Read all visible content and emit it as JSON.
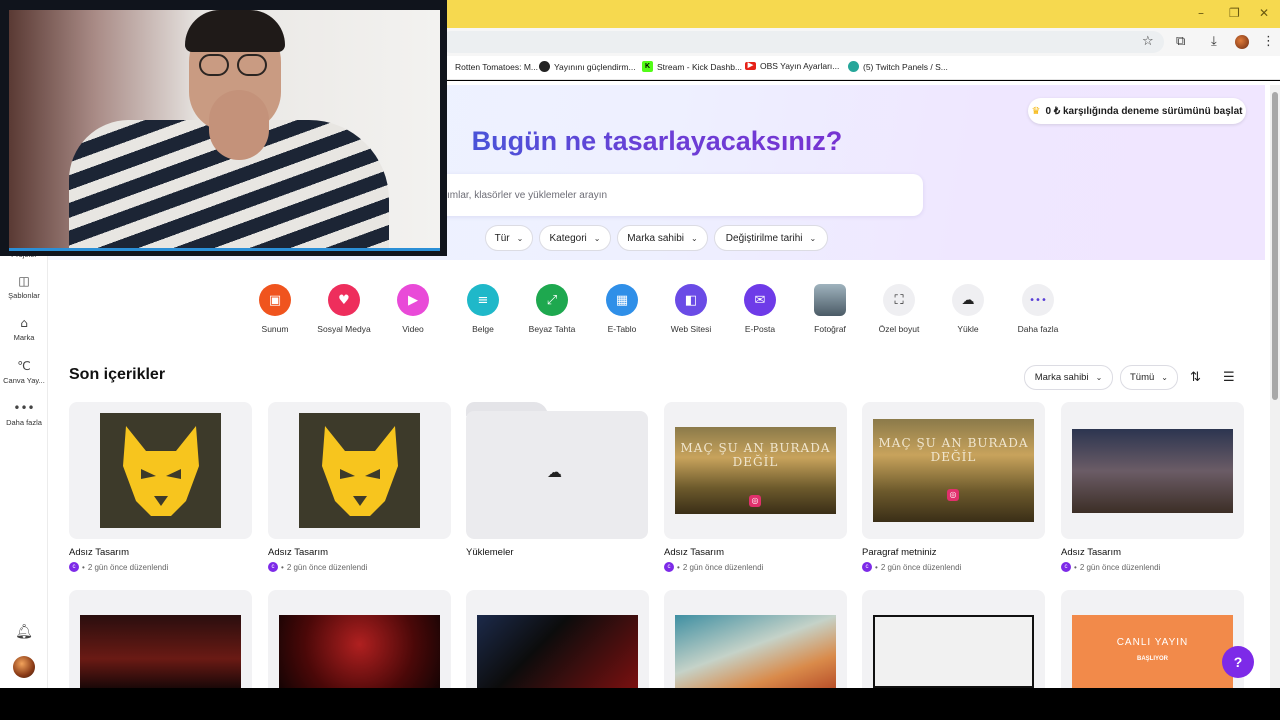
{
  "bookmarks": [
    {
      "label": "Rotten Tomatoes: M...",
      "icon": "rotten-tomatoes-icon"
    },
    {
      "label": "Yayınını güçlendirm...",
      "icon": "github-icon"
    },
    {
      "label": "Stream - Kick Dashb...",
      "icon": "kick-icon"
    },
    {
      "label": "OBS Yayın Ayarları...",
      "icon": "youtube-icon"
    },
    {
      "label": "(5) Twitch Panels / S...",
      "icon": "twitch-icon"
    }
  ],
  "sidebar": {
    "items": [
      {
        "label": "Projeler",
        "icon": "folder-icon"
      },
      {
        "label": "Şablonlar",
        "icon": "template-icon"
      },
      {
        "label": "Marka",
        "icon": "brand-icon"
      },
      {
        "label": "Canva Yay...",
        "icon": "canva-icon"
      },
      {
        "label": "Daha fazla",
        "icon": "more-icon"
      }
    ]
  },
  "hero": {
    "trial_label": "0 ₺ karşılığında deneme sürümünü başlat",
    "title": "Bugün ne tasarlayacaksınız?",
    "search_placeholder": "ımlar, klasörler ve yüklemeler arayın",
    "filters": [
      "Tür",
      "Kategori",
      "Marka sahibi",
      "Değiştirilme tarihi"
    ]
  },
  "categories": [
    {
      "label": "Sunum",
      "color": "#f0541e",
      "icon": "presentation-icon"
    },
    {
      "label": "Sosyal Medya",
      "color": "#ee2e5c",
      "icon": "heart-icon"
    },
    {
      "label": "Video",
      "color": "#e94ad8",
      "icon": "video-icon"
    },
    {
      "label": "Belge",
      "color": "#1fb8c9",
      "icon": "document-icon"
    },
    {
      "label": "Beyaz Tahta",
      "color": "#1ea84f",
      "icon": "whiteboard-icon"
    },
    {
      "label": "E-Tablo",
      "color": "#2f8fe8",
      "icon": "spreadsheet-icon"
    },
    {
      "label": "Web Sitesi",
      "color": "#6a4be6",
      "icon": "website-icon"
    },
    {
      "label": "E-Posta",
      "color": "#6e3be8",
      "icon": "email-icon"
    },
    {
      "label": "Fotoğraf",
      "color": "#7a8b95",
      "icon": "photo-icon"
    },
    {
      "label": "Özel boyut",
      "color": "#efeff2",
      "icon": "custom-size-icon"
    },
    {
      "label": "Yükle",
      "color": "#efeff2",
      "icon": "upload-icon"
    },
    {
      "label": "Daha fazla",
      "color": "#efeff2",
      "icon": "more-icon"
    }
  ],
  "recent": {
    "title": "Son içerikler",
    "owner_filter": "Marka sahibi",
    "type_filter": "Tümü",
    "items": [
      {
        "title": "Adsız Tasarım",
        "meta": "2 gün önce düzenlendi"
      },
      {
        "title": "Adsız Tasarım",
        "meta": "2 gün önce düzenlendi"
      },
      {
        "title": "Yüklemeler",
        "meta": ""
      },
      {
        "title": "Adsız Tasarım",
        "meta": "2 gün önce düzenlendi"
      },
      {
        "title": "Paragraf metniniz",
        "meta": "2 gün önce düzenlendi"
      },
      {
        "title": "Adsız Tasarım",
        "meta": "2 gün önce düzenlendi"
      }
    ],
    "thumb_text": [
      "MAÇ ŞU AN BURADA DEĞİL",
      "MAÇ ŞU AN BURADA DEĞİL",
      "CANLI YAYIN",
      "BAŞLIYOR"
    ]
  },
  "help_label": "?"
}
